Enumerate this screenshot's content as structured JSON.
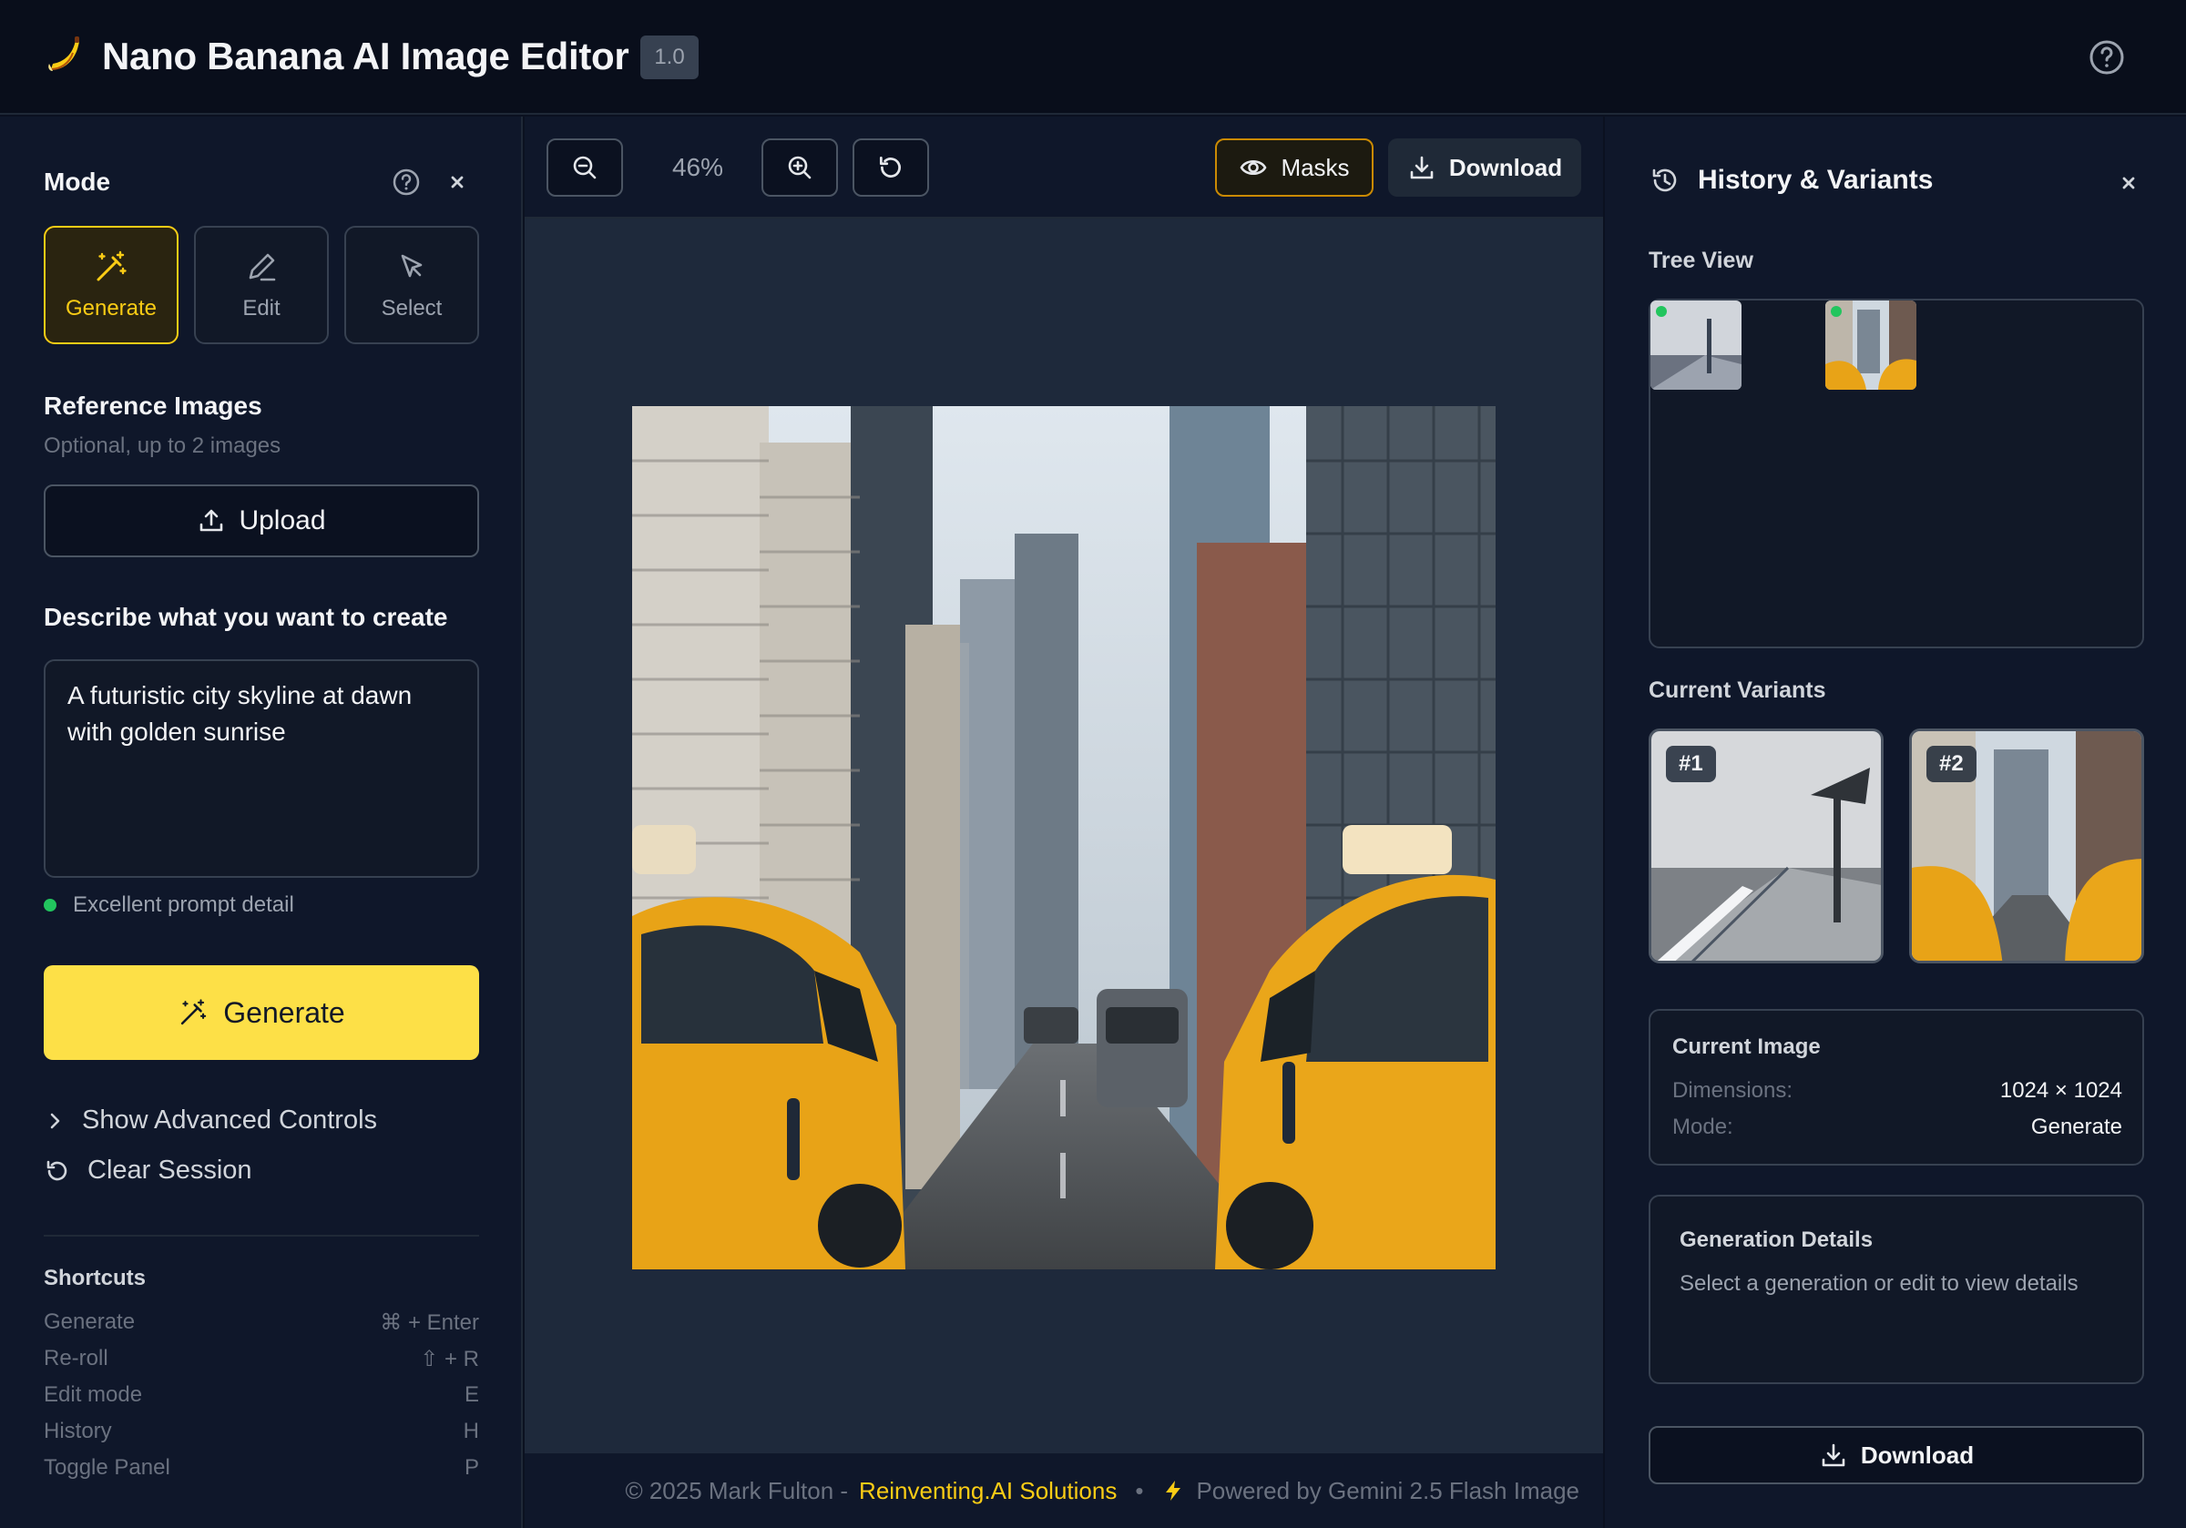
{
  "header": {
    "title": "Nano Banana AI Image Editor",
    "version": "1.0"
  },
  "left": {
    "mode_title": "Mode",
    "modes": [
      {
        "label": "Generate",
        "icon": "wand-sparkles-icon",
        "active": true
      },
      {
        "label": "Edit",
        "icon": "pencil-icon",
        "active": false
      },
      {
        "label": "Select",
        "icon": "cursor-click-icon",
        "active": false
      }
    ],
    "reference_title": "Reference Images",
    "reference_sub": "Optional, up to 2 images",
    "upload_label": "Upload",
    "describe_title": "Describe what you want to create",
    "prompt_value": "A futuristic city skyline at dawn with golden sunrise",
    "quality_label": "Excellent prompt detail",
    "generate_label": "Generate",
    "advanced_label": "Show Advanced Controls",
    "clear_label": "Clear Session",
    "shortcuts_title": "Shortcuts",
    "shortcuts": [
      {
        "name": "Generate",
        "keys": "⌘ + Enter"
      },
      {
        "name": "Re-roll",
        "keys": "⇧ + R"
      },
      {
        "name": "Edit mode",
        "keys": "E"
      },
      {
        "name": "History",
        "keys": "H"
      },
      {
        "name": "Toggle Panel",
        "keys": "P"
      }
    ]
  },
  "toolbar": {
    "zoom": "46%",
    "masks_label": "Masks",
    "download_label": "Download"
  },
  "footer": {
    "copyright": "© 2025 Mark Fulton -",
    "brand": "Reinventing.AI Solutions",
    "separator": "•",
    "powered": "Powered by Gemini 2.5 Flash Image"
  },
  "right": {
    "title": "History & Variants",
    "tree_label": "Tree View",
    "variants_label": "Current Variants",
    "variants": [
      "#1",
      "#2"
    ],
    "current_image": {
      "title": "Current Image",
      "dimensions_key": "Dimensions:",
      "dimensions_value": "1024 × 1024",
      "mode_key": "Mode:",
      "mode_value": "Generate"
    },
    "generation_details": {
      "title": "Generation Details",
      "text": "Select a generation or edit to view details"
    },
    "download_label": "Download"
  },
  "colors": {
    "accent": "#facc15",
    "background": "#0f172a",
    "success": "#22c55e"
  }
}
